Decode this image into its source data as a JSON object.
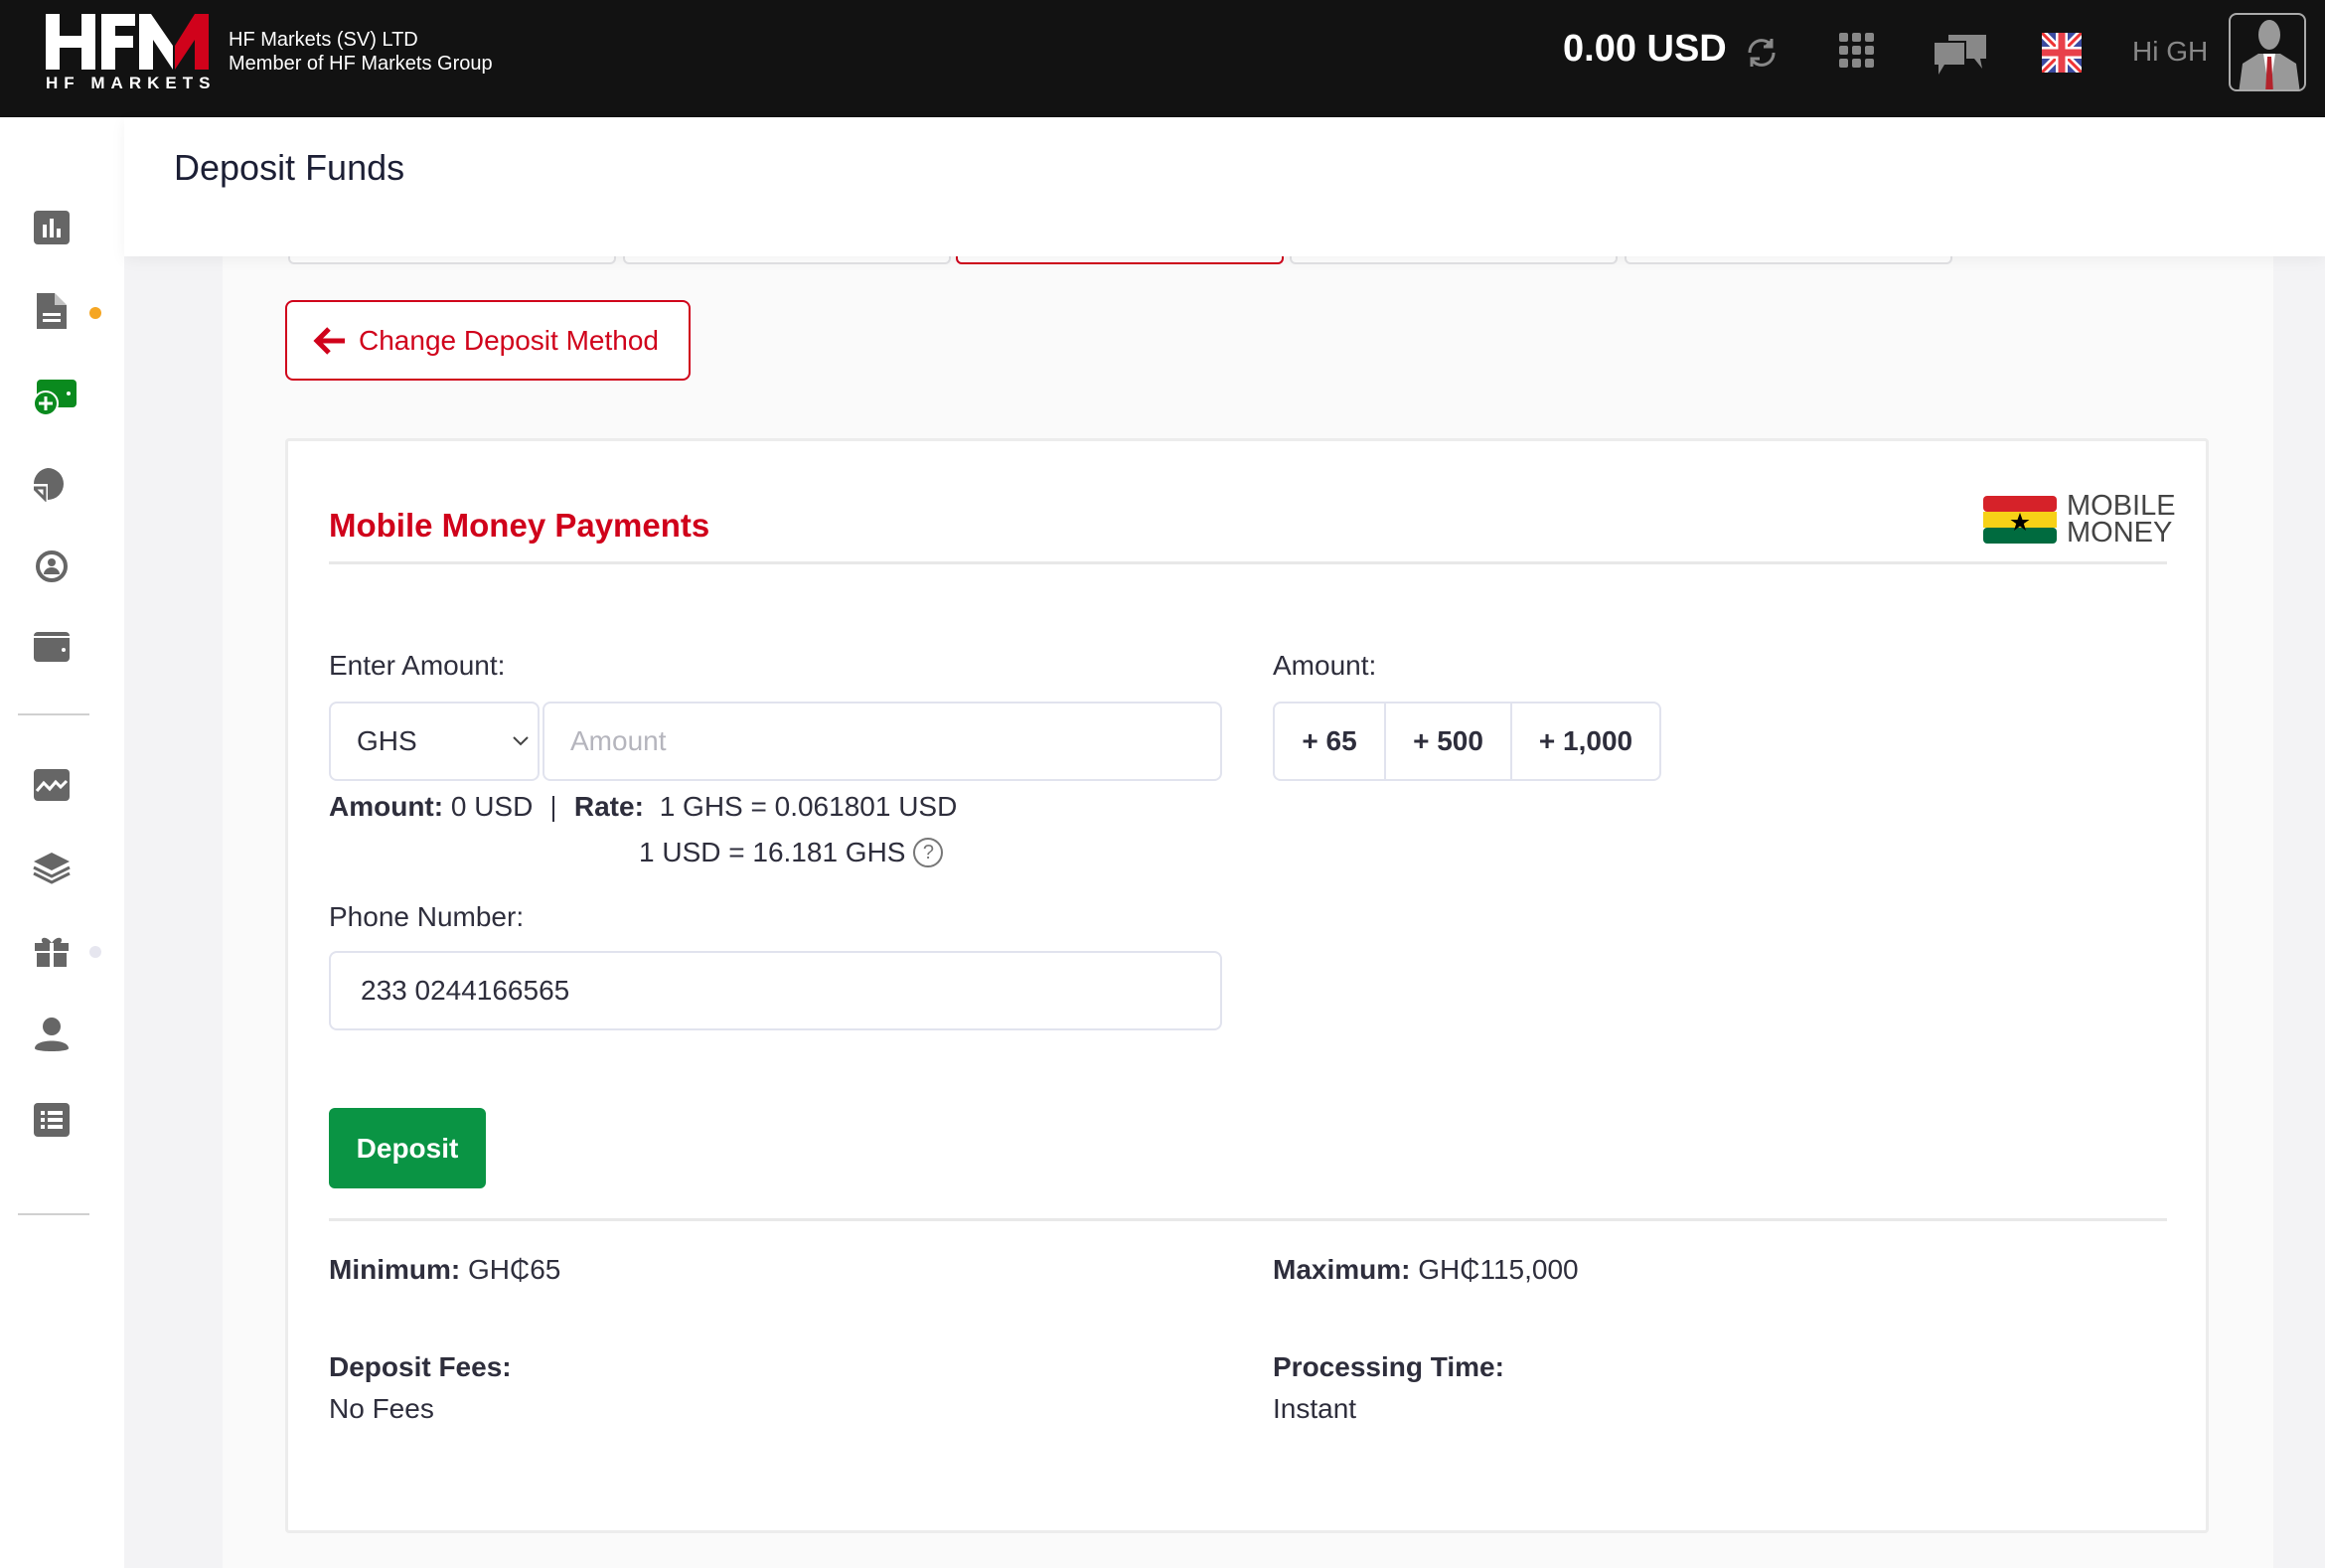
{
  "header": {
    "logo_text": "HFM",
    "logo_subtitle": "HF MARKETS",
    "company_line1": "HF Markets (SV) LTD",
    "company_line2": "Member of HF Markets Group",
    "balance": "0.00 USD",
    "greeting": "Hi GH",
    "icons": [
      "refresh-icon",
      "apps-grid-icon",
      "chat-icon",
      "uk-flag-icon",
      "avatar"
    ]
  },
  "sidebar": {
    "items": [
      {
        "icon": "bar-chart-icon"
      },
      {
        "icon": "document-icon",
        "badge_color": "#f5a623"
      },
      {
        "icon": "deposit-icon",
        "active": true,
        "color": "#0a8a1e"
      },
      {
        "icon": "pie-chart-icon"
      },
      {
        "icon": "account-transfer-icon"
      },
      {
        "icon": "wallet-icon"
      },
      {
        "icon": "analytics-icon"
      },
      {
        "icon": "layers-icon"
      },
      {
        "icon": "gift-icon",
        "badge_color": "#e6e6ef"
      },
      {
        "icon": "user-icon"
      },
      {
        "icon": "list-icon"
      }
    ]
  },
  "page": {
    "title": "Deposit Funds"
  },
  "change_method_label": "Change Deposit Method",
  "card": {
    "title": "Mobile Money Payments",
    "logo_text_line1": "MOBILE",
    "logo_text_line2": "MONEY",
    "enter_amount_label": "Enter Amount:",
    "currency_selected": "GHS",
    "amount_placeholder": "Amount",
    "quick_amount_label": "Amount:",
    "quick_amounts": [
      "+ 65",
      "+ 500",
      "+ 1,000"
    ],
    "amount_summary_label": "Amount:",
    "amount_summary_value": "0 USD",
    "rate_label": "Rate:",
    "rate_line1": "1 GHS = 0.061801 USD",
    "rate_line2": "1 USD = 16.181 GHS",
    "phone_label": "Phone Number:",
    "phone_value": "233 0244166565",
    "deposit_button": "Deposit",
    "minimum_label": "Minimum:",
    "minimum_value": "GH₵65",
    "maximum_label": "Maximum:",
    "maximum_value": "GH₵115,000",
    "fees_label": "Deposit Fees:",
    "fees_value": "No Fees",
    "processing_label": "Processing Time:",
    "processing_value": "Instant"
  },
  "colors": {
    "brand_red": "#d0021b",
    "deposit_green": "#0a9444",
    "header_bg": "#121212"
  }
}
